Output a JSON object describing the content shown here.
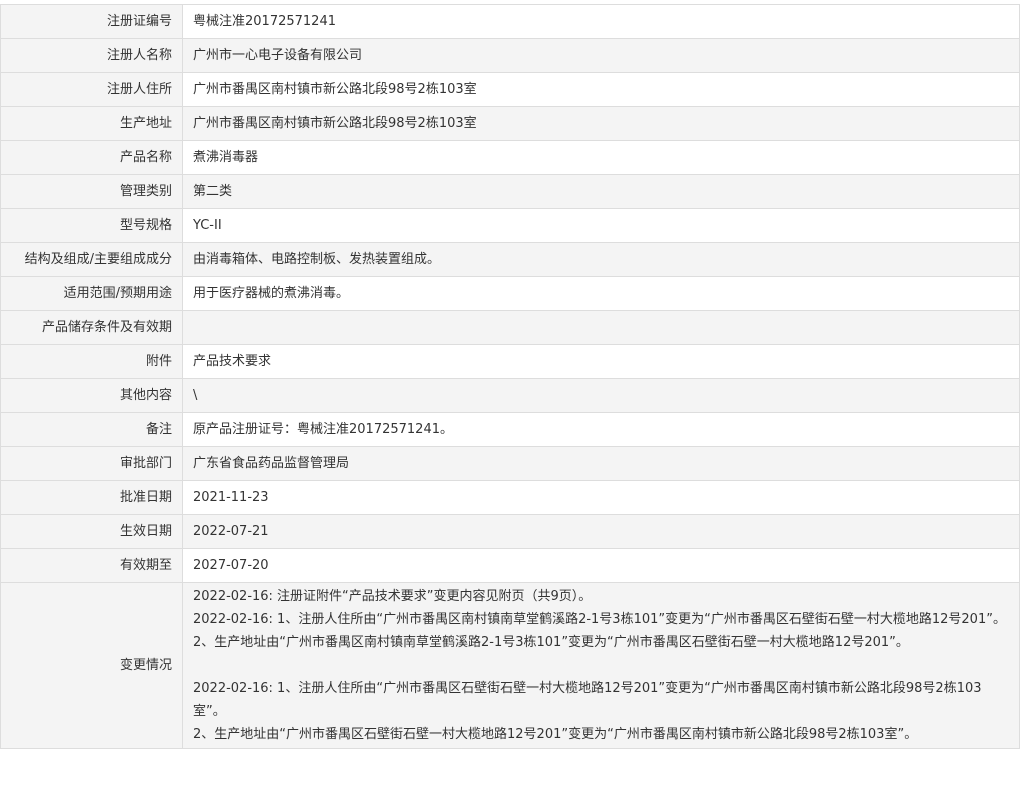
{
  "rows": [
    {
      "label": "注册证编号",
      "value": "粤械注准20172571241"
    },
    {
      "label": "注册人名称",
      "value": "广州市一心电子设备有限公司"
    },
    {
      "label": "注册人住所",
      "value": "广州市番禺区南村镇市新公路北段98号2栋103室"
    },
    {
      "label": "生产地址",
      "value": "广州市番禺区南村镇市新公路北段98号2栋103室"
    },
    {
      "label": "产品名称",
      "value": "煮沸消毒器"
    },
    {
      "label": "管理类别",
      "value": "第二类"
    },
    {
      "label": "型号规格",
      "value": "YC-II"
    },
    {
      "label": "结构及组成/主要组成成分",
      "value": "由消毒箱体、电路控制板、发热装置组成。"
    },
    {
      "label": "适用范围/预期用途",
      "value": "用于医疗器械的煮沸消毒。"
    },
    {
      "label": "产品储存条件及有效期",
      "value": ""
    },
    {
      "label": "附件",
      "value": "产品技术要求"
    },
    {
      "label": "其他内容",
      "value": "\\"
    },
    {
      "label": "备注",
      "value": "原产品注册证号：粤械注准20172571241。"
    },
    {
      "label": "审批部门",
      "value": "广东省食品药品监督管理局"
    },
    {
      "label": "批准日期",
      "value": "2021-11-23"
    },
    {
      "label": "生效日期",
      "value": "2022-07-21"
    },
    {
      "label": "有效期至",
      "value": "2027-07-20"
    }
  ],
  "changes": {
    "label": "变更情况",
    "lines": [
      "2022-02-16: 注册证附件“产品技术要求”变更内容见附页（共9页）。",
      "2022-02-16: 1、注册人住所由“广州市番禺区南村镇南草堂鹤溪路2-1号3栋101”变更为“广州市番禺区石壁街石壁一村大榄地路12号201”。",
      "2、生产地址由“广州市番禺区南村镇南草堂鹤溪路2-1号3栋101”变更为“广州市番禺区石壁街石壁一村大榄地路12号201”。",
      "",
      "2022-02-16: 1、注册人住所由“广州市番禺区石壁街石壁一村大榄地路12号201”变更为“广州市番禺区南村镇市新公路北段98号2栋103室”。",
      "2、生产地址由“广州市番禺区石壁街石壁一村大榄地路12号201”变更为“广州市番禺区南村镇市新公路北段98号2栋103室”。"
    ]
  }
}
